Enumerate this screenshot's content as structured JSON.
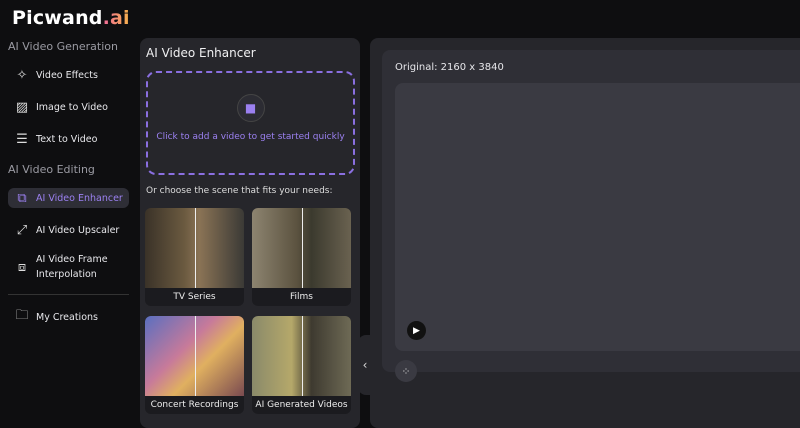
{
  "brand": {
    "name": "Picwand",
    "suffix": ".ai"
  },
  "sidebar": {
    "sections": [
      {
        "title": "AI Video Generation",
        "items": [
          {
            "label": "Video Effects",
            "icon": "sparkle-icon"
          },
          {
            "label": "Image to Video",
            "icon": "image-video-icon"
          },
          {
            "label": "Text to Video",
            "icon": "text-video-icon"
          }
        ]
      },
      {
        "title": "AI Video Editing",
        "items": [
          {
            "label": "AI Video Enhancer",
            "icon": "enhance-icon",
            "active": true
          },
          {
            "label": "AI Video Upscaler",
            "icon": "upscale-icon"
          },
          {
            "label": "AI Video Frame Interpolation",
            "icon": "frames-icon"
          }
        ]
      }
    ],
    "footer": {
      "label": "My Creations",
      "icon": "folder-icon"
    }
  },
  "panel": {
    "title": "AI Video Enhancer",
    "upload_text": "Click to add a video to get started quickly",
    "choose_text": "Or choose the scene that fits your needs:",
    "scenes": [
      "TV Series",
      "Films",
      "Concert Recordings",
      "AI Generated Videos"
    ]
  },
  "preview": {
    "original_label": "Original: 2160 x 3840"
  },
  "colors": {
    "accent": "#9b80f0",
    "background": "#0e0e10",
    "panel": "#26262b"
  }
}
